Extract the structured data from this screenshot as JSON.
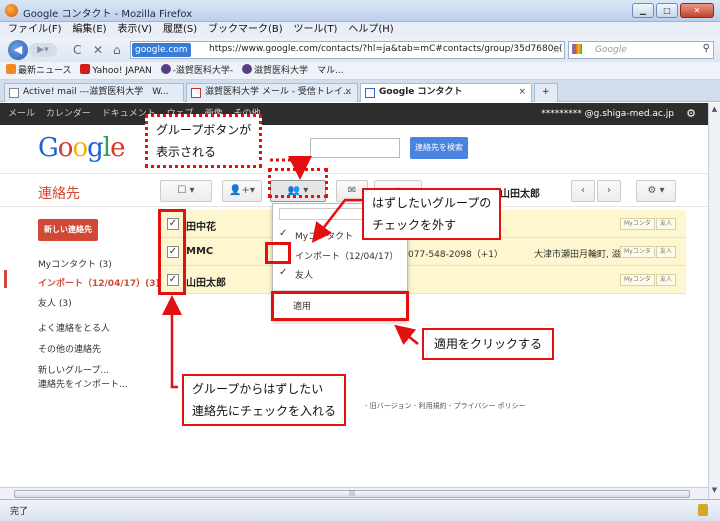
{
  "window": {
    "title": "Google コンタクト - Mozilla Firefox"
  },
  "menubar": [
    "ファイル(F)",
    "編集(E)",
    "表示(V)",
    "履歴(S)",
    "ブックマーク(B)",
    "ツール(T)",
    "ヘルプ(H)"
  ],
  "nav": {
    "url_site": "google.com",
    "url": "https://www.google.com/contacts/?hl=ja&tab=mC#contacts/group/35d7680e(",
    "search_placeholder": "Google"
  },
  "bookmarks": [
    "最新ニュース",
    "Yahoo! JAPAN",
    "-滋賀医科大学-",
    "滋賀医科大学　マル..."
  ],
  "tabs": [
    {
      "label": "Active! mail ---滋賀医科大学　W..."
    },
    {
      "label": "滋賀医科大学 メール - 受信トレイ..."
    },
    {
      "label": "Google コンタクト"
    }
  ],
  "gbar": {
    "links": [
      "メール",
      "カレンダー",
      "ドキュメント",
      "ウェブ",
      "画像",
      "その他"
    ],
    "email": "********* @g.shiga-med.ac.jp"
  },
  "search_button": "連絡先を検索",
  "page_title": "連絡先",
  "selected_name": "山田太郎",
  "new_contact": "新しい連絡先",
  "sidebar": [
    "Myコンタクト (3)",
    "インポート（12/04/17）(3)",
    "友人 (3)",
    "よく連絡をとる人",
    "その他の連絡先",
    "新しいグループ...",
    "連絡先をインポート..."
  ],
  "contacts": [
    {
      "name": "田中花",
      "phone": "",
      "address": "",
      "badges": [
        "Myコンタ",
        "友人"
      ]
    },
    {
      "name": "MMC",
      "phone": "077-548-2098（+1）",
      "address": "大津市瀬田月輪町, 滋",
      "badges": [
        "Myコンタ",
        "友人"
      ]
    },
    {
      "name": "山田太郎",
      "phone": "",
      "address": "",
      "badges": [
        "Myコンタ",
        "友人"
      ]
    }
  ],
  "dropdown": {
    "items": [
      "Myコンタクト",
      "インポート（12/04/17）",
      "友人"
    ],
    "apply": "適用"
  },
  "footer_links": "- 旧バージョン - 利用規約 - プライバシー ポリシー",
  "annotations": {
    "group_button": [
      "グループボタンが",
      "表示される"
    ],
    "uncheck_group": [
      "はずしたいグループの",
      "チェックを外す"
    ],
    "click_apply": "適用をクリックする",
    "check_contacts": [
      "グループからはずしたい",
      "連絡先にチェックを入れる"
    ]
  },
  "status": "完了",
  "colors": {
    "annotation": "#e41010",
    "accent": "#d14836",
    "selected_row": "#fdf6cf"
  }
}
